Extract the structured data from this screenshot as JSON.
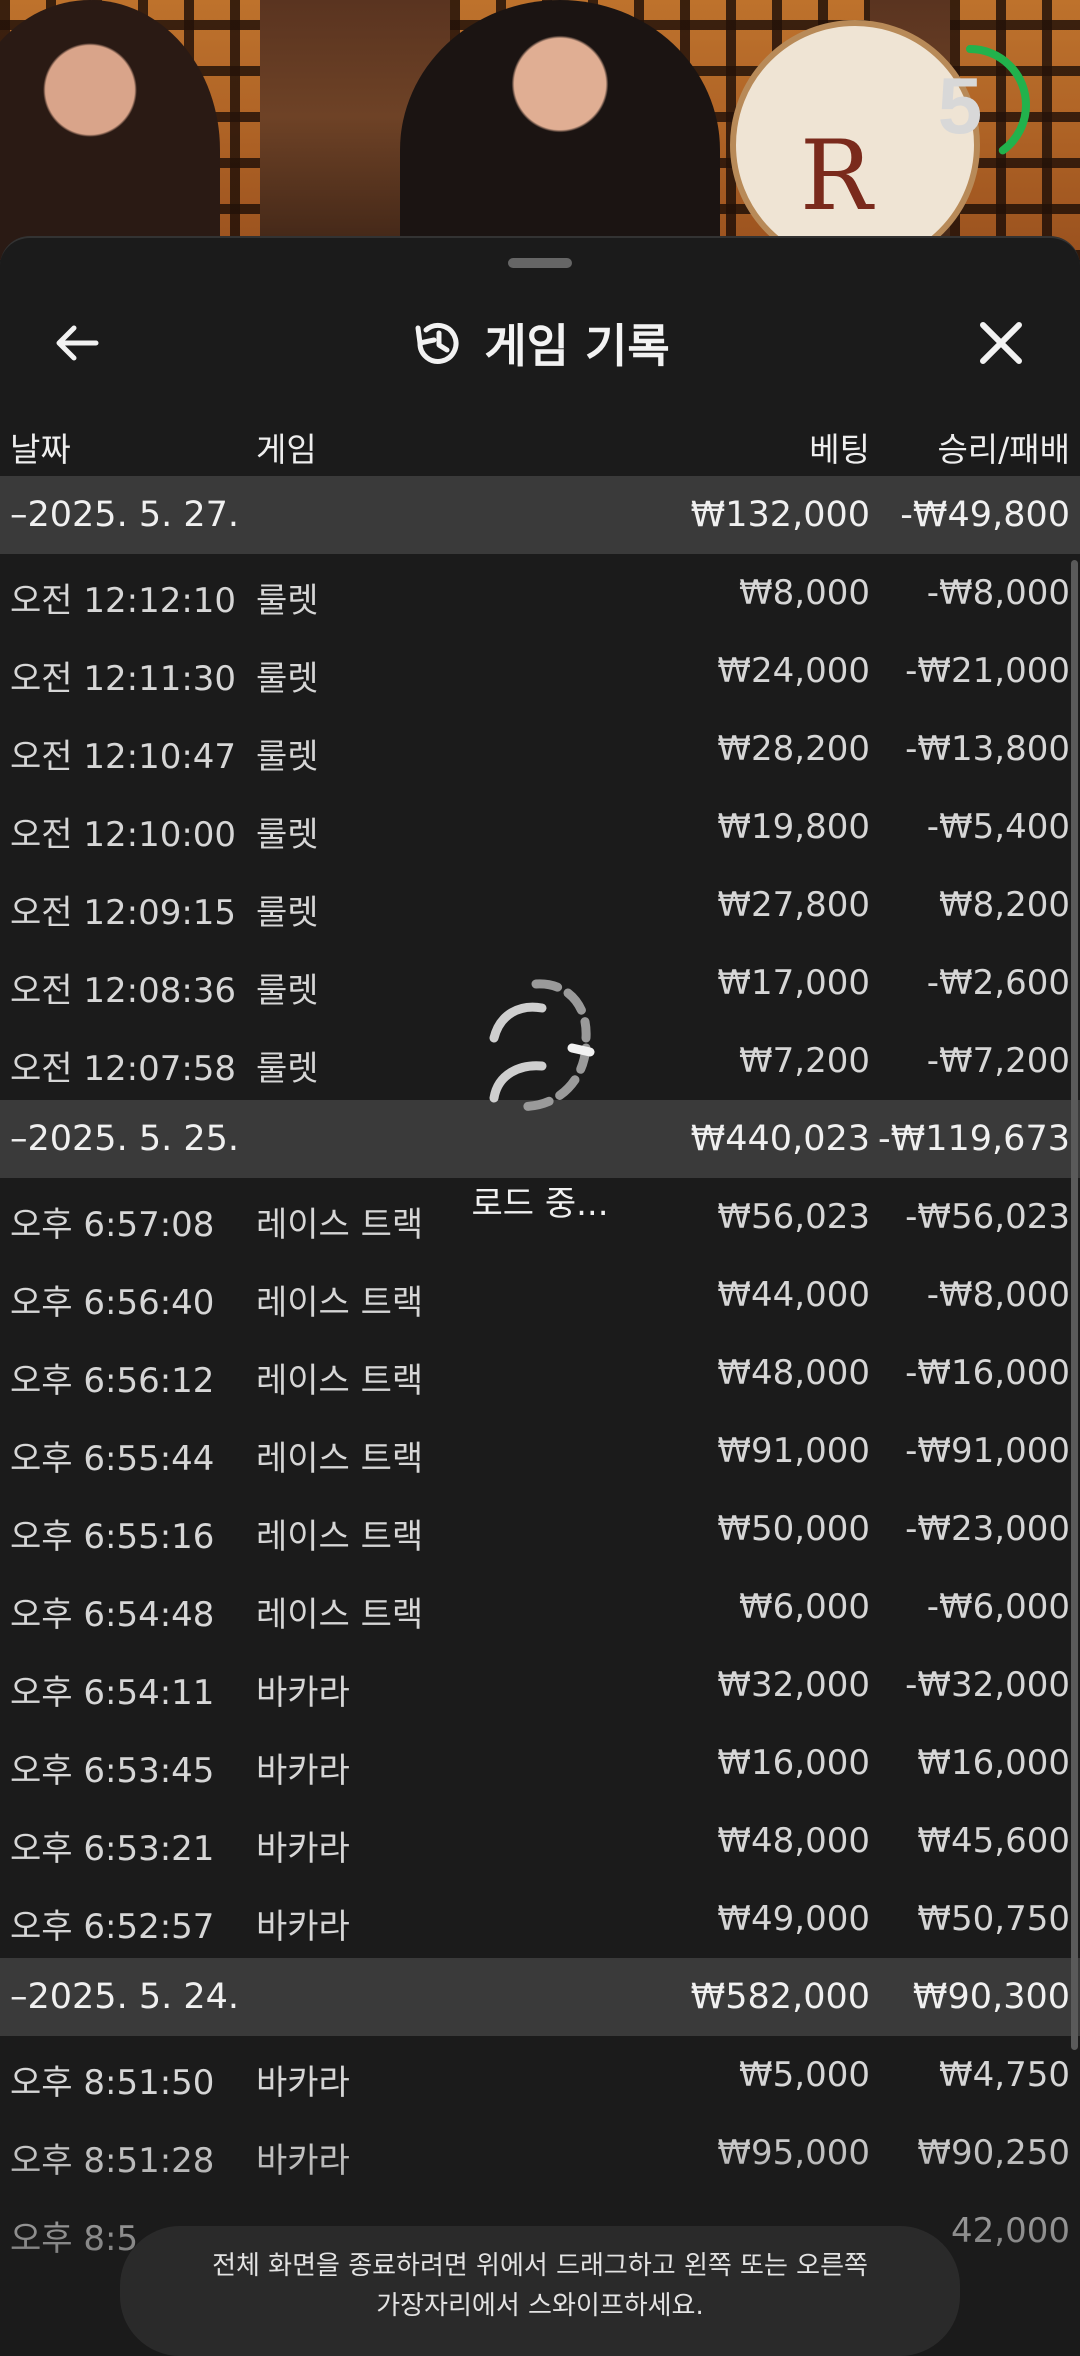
{
  "timer": {
    "value": "5",
    "progress": 0.4
  },
  "header": {
    "title": "게임 기록"
  },
  "columns": {
    "date": "날짜",
    "game": "게임",
    "bet": "베팅",
    "winloss": "승리/패배"
  },
  "groups": [
    {
      "date": "–2025. 5. 27.",
      "bet": "₩132,000",
      "winloss": "-₩49,800",
      "rows": [
        {
          "time": "오전 12:12:10",
          "game": "룰렛",
          "bet": "₩8,000",
          "winloss": "-₩8,000"
        },
        {
          "time": "오전 12:11:30",
          "game": "룰렛",
          "bet": "₩24,000",
          "winloss": "-₩21,000"
        },
        {
          "time": "오전 12:10:47",
          "game": "룰렛",
          "bet": "₩28,200",
          "winloss": "-₩13,800"
        },
        {
          "time": "오전 12:10:00",
          "game": "룰렛",
          "bet": "₩19,800",
          "winloss": "-₩5,400"
        },
        {
          "time": "오전 12:09:15",
          "game": "룰렛",
          "bet": "₩27,800",
          "winloss": "₩8,200"
        },
        {
          "time": "오전 12:08:36",
          "game": "룰렛",
          "bet": "₩17,000",
          "winloss": "-₩2,600"
        },
        {
          "time": "오전 12:07:58",
          "game": "룰렛",
          "bet": "₩7,200",
          "winloss": "-₩7,200"
        }
      ]
    },
    {
      "date": "–2025. 5. 25.",
      "bet": "₩440,023",
      "winloss": "-₩119,673",
      "rows": [
        {
          "time": "오후 6:57:08",
          "game": "레이스 트랙",
          "bet": "₩56,023",
          "winloss": "-₩56,023"
        },
        {
          "time": "오후 6:56:40",
          "game": "레이스 트랙",
          "bet": "₩44,000",
          "winloss": "-₩8,000"
        },
        {
          "time": "오후 6:56:12",
          "game": "레이스 트랙",
          "bet": "₩48,000",
          "winloss": "-₩16,000"
        },
        {
          "time": "오후 6:55:44",
          "game": "레이스 트랙",
          "bet": "₩91,000",
          "winloss": "-₩91,000"
        },
        {
          "time": "오후 6:55:16",
          "game": "레이스 트랙",
          "bet": "₩50,000",
          "winloss": "-₩23,000"
        },
        {
          "time": "오후 6:54:48",
          "game": "레이스 트랙",
          "bet": "₩6,000",
          "winloss": "-₩6,000"
        },
        {
          "time": "오후 6:54:11",
          "game": "바카라",
          "bet": "₩32,000",
          "winloss": "-₩32,000"
        },
        {
          "time": "오후 6:53:45",
          "game": "바카라",
          "bet": "₩16,000",
          "winloss": "₩16,000"
        },
        {
          "time": "오후 6:53:21",
          "game": "바카라",
          "bet": "₩48,000",
          "winloss": "₩45,600"
        },
        {
          "time": "오후 6:52:57",
          "game": "바카라",
          "bet": "₩49,000",
          "winloss": "₩50,750"
        }
      ]
    },
    {
      "date": "–2025. 5. 24.",
      "bet": "₩582,000",
      "winloss": "₩90,300",
      "rows": [
        {
          "time": "오후 8:51:50",
          "game": "바카라",
          "bet": "₩5,000",
          "winloss": "₩4,750"
        },
        {
          "time": "오후 8:51:28",
          "game": "바카라",
          "bet": "₩95,000",
          "winloss": "₩90,250"
        },
        {
          "time": "오후 8:5",
          "game": "",
          "bet": "",
          "winloss": "42,000"
        }
      ]
    }
  ],
  "loading": {
    "text": "로드 중..."
  },
  "toast": {
    "line1": "전체 화면을 종료하려면 위에서 드래그하고 왼쪽 또는 오른쪽",
    "line2": "가장자리에서 스와이프하세요."
  },
  "icons": {
    "back": "back-arrow-icon",
    "history": "history-icon",
    "close": "close-icon",
    "spinner": "loading-spinner-icon"
  },
  "colors": {
    "timer_ring": "#22b24c",
    "date_row_bg": "#3a3a3a",
    "sheet_bg": "#1b1b1b"
  }
}
